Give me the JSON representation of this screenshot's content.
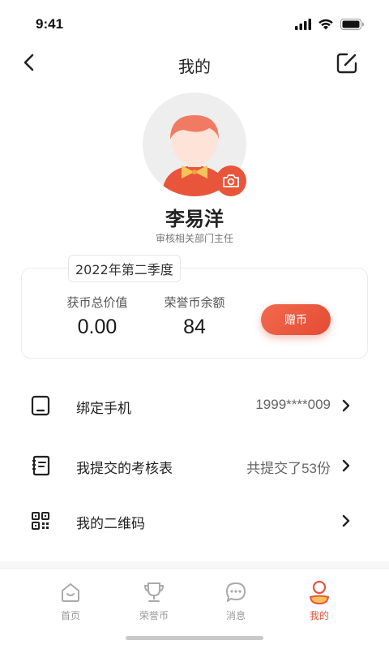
{
  "status_bar": {
    "time": "9:41",
    "icons": [
      "signal-icon",
      "wifi-icon",
      "battery-icon"
    ]
  },
  "nav": {
    "title": "我的",
    "back_icon": "back-arrow-icon",
    "edit_icon": "edit-icon"
  },
  "profile": {
    "name": "李易洋",
    "role": "审核相关部门主任",
    "avatar_icon": "avatar-illustration",
    "camera_icon": "camera-icon"
  },
  "stats": {
    "season": "2022年第二季度",
    "coins_total_label": "获币总价值",
    "coins_total_value": "0.00",
    "honor_balance_label": "荣誉币余额",
    "honor_balance_value": "84",
    "gift_button_label": "赠币"
  },
  "menu": [
    {
      "icon": "phone-icon",
      "label": "绑定手机",
      "value": "1999****009"
    },
    {
      "icon": "form-icon",
      "label": "我提交的考核表",
      "value": "共提交了53份"
    },
    {
      "icon": "qrcode-icon",
      "label": "我的二维码",
      "value": ""
    }
  ],
  "tabs": [
    {
      "icon": "home-icon",
      "label": "首页",
      "active": false
    },
    {
      "icon": "trophy-icon",
      "label": "荣誉币",
      "active": false
    },
    {
      "icon": "message-icon",
      "label": "消息",
      "active": false
    },
    {
      "icon": "profile-icon",
      "label": "我的",
      "active": true
    }
  ],
  "colors": {
    "accent": "#e8553a",
    "text_primary": "#222222",
    "text_secondary": "#777777",
    "tab_inactive": "#999999"
  }
}
